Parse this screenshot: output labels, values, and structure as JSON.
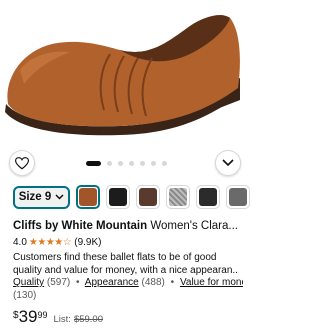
{
  "product_image": {
    "icon": "brown-ballet-flat-shoe-image",
    "color": "#b1622c"
  },
  "carousel": {
    "slide_count": 7,
    "active_index": 0
  },
  "actions": {
    "wishlist_icon": "heart-icon",
    "share_icon": "chevron-down-icon"
  },
  "variations": {
    "size_label": "Size 9",
    "colors": [
      "#a3552a",
      "#1c1c1c",
      "#5b3a2e",
      "#9a9a9a",
      "#2b2b2b",
      "#6a6a6a"
    ],
    "selected_color_index": 0
  },
  "listing": {
    "brand": "Cliffs by White Mountain",
    "title": "Women's Clara...",
    "rating": "4.0",
    "stars": "★★★★☆",
    "rating_count": "(9.9K)",
    "review_line1": "Customers find these ballet flats to be of good",
    "review_line2": "quality and value for money, with a nice appearan...",
    "aspects": [
      {
        "label": "Quality",
        "count": "(597)"
      },
      {
        "label": "Appearance",
        "count": "(488)"
      },
      {
        "label": "Value for money",
        "count": "(130)"
      }
    ],
    "price_symbol": "$",
    "price_whole": "39",
    "price_fraction": "99",
    "list_label": "List:",
    "list_price": "$59.00"
  }
}
